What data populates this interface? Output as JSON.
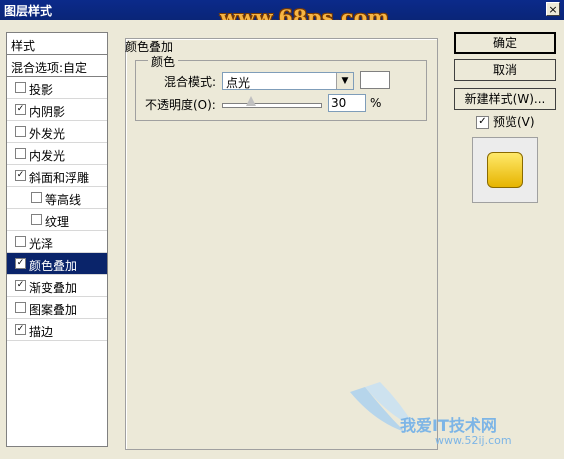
{
  "window": {
    "title": "图层样式",
    "close": "×",
    "watermark": "www.68ps.com"
  },
  "list": {
    "header": "样式",
    "blend_options": "混合选项:自定",
    "items": [
      {
        "label": "投影",
        "checked": false,
        "indent": false,
        "selected": false
      },
      {
        "label": "内阴影",
        "checked": true,
        "indent": false,
        "selected": false
      },
      {
        "label": "外发光",
        "checked": false,
        "indent": false,
        "selected": false
      },
      {
        "label": "内发光",
        "checked": false,
        "indent": false,
        "selected": false
      },
      {
        "label": "斜面和浮雕",
        "checked": true,
        "indent": false,
        "selected": false
      },
      {
        "label": "等高线",
        "checked": false,
        "indent": true,
        "selected": false
      },
      {
        "label": "纹理",
        "checked": false,
        "indent": true,
        "selected": false
      },
      {
        "label": "光泽",
        "checked": false,
        "indent": false,
        "selected": false
      },
      {
        "label": "颜色叠加",
        "checked": true,
        "indent": false,
        "selected": true
      },
      {
        "label": "渐变叠加",
        "checked": true,
        "indent": false,
        "selected": false
      },
      {
        "label": "图案叠加",
        "checked": false,
        "indent": false,
        "selected": false
      },
      {
        "label": "描边",
        "checked": true,
        "indent": false,
        "selected": false
      }
    ]
  },
  "panel": {
    "group_title": "颜色叠加",
    "sub_title": "颜色",
    "blend_mode_label": "混合模式:",
    "blend_mode_value": "点光",
    "opacity_label": "不透明度(O):",
    "opacity_value": "30",
    "opacity_unit": "%",
    "opacity_level": 0.3
  },
  "buttons": {
    "ok": "确定",
    "cancel": "取消",
    "new_style": "新建样式(W)...",
    "preview": "预览(V)",
    "preview_checked": true
  },
  "logo": {
    "text": "我爱IT技术网",
    "url": "www.52ij.com"
  }
}
